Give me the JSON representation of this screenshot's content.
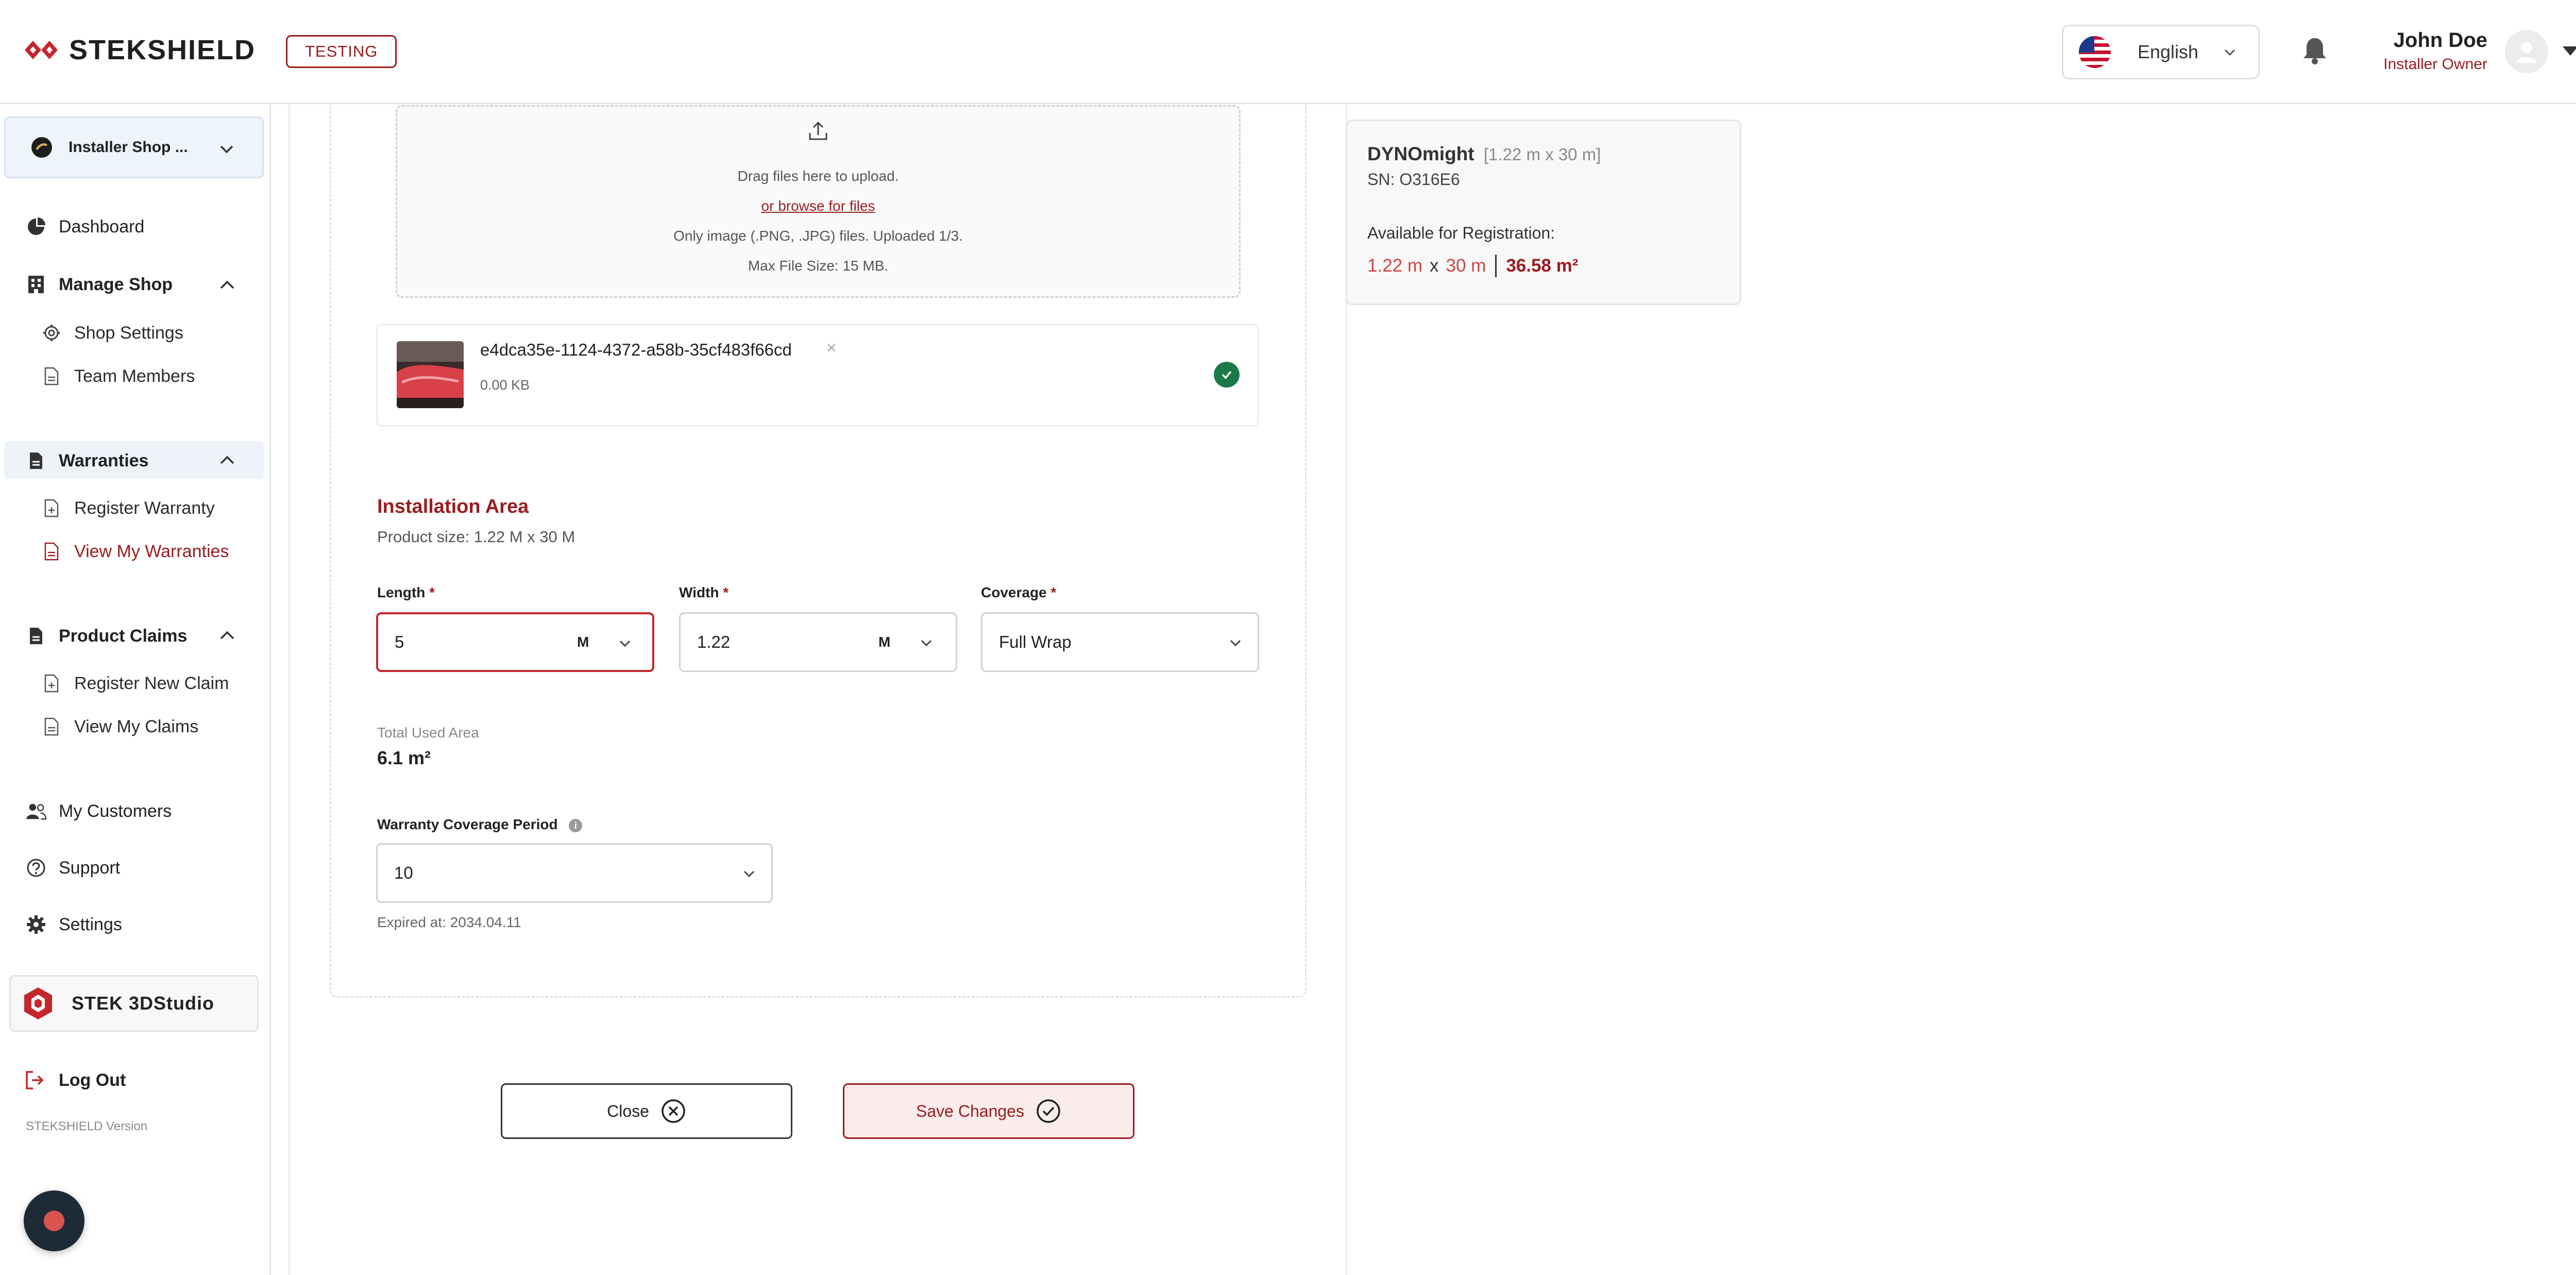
{
  "header": {
    "brand": "STEKSHIELD",
    "env_badge": "TESTING",
    "language": "English",
    "user_name": "John Doe",
    "user_role": "Installer Owner"
  },
  "sidebar": {
    "shop_selector": "Installer Shop ...",
    "dashboard": "Dashboard",
    "manage_shop": "Manage Shop",
    "shop_settings": "Shop Settings",
    "team_members": "Team Members",
    "warranties": "Warranties",
    "register_warranty": "Register Warranty",
    "view_my_warranties": "View My Warranties",
    "product_claims": "Product Claims",
    "register_new_claim": "Register New Claim",
    "view_my_claims": "View My Claims",
    "my_customers": "My Customers",
    "support": "Support",
    "settings": "Settings",
    "stek_studio": "STEK 3DStudio",
    "logout": "Log Out",
    "version": "STEKSHIELD Version"
  },
  "upload": {
    "drag_text": "Drag files here to upload.",
    "browse_link": "or browse for files",
    "file_types": "Only image (.PNG, .JPG) files. Uploaded 1/3.",
    "max_size": "Max File Size: 15 MB.",
    "file_name": "e4dca35e-1124-4372-a58b-35cf483f66cd",
    "file_size": "0.00 KB",
    "remove_glyph": "×"
  },
  "installation": {
    "title": "Installation Area",
    "product_size": "Product size: 1.22 M x 30 M",
    "length_label": "Length",
    "length_value": "5",
    "length_unit": "M",
    "width_label": "Width",
    "width_value": "1.22",
    "width_unit": "M",
    "coverage_label": "Coverage",
    "coverage_value": "Full Wrap",
    "required_mark": "*",
    "total_label": "Total Used Area",
    "total_value": "6.1 m²",
    "warranty_label": "Warranty Coverage Period",
    "warranty_value": "10",
    "expired": "Expired at: 2034.04.11"
  },
  "actions": {
    "close": "Close",
    "save": "Save Changes"
  },
  "product_card": {
    "name": "DYNOmight",
    "dims": "[1.22 m x 30 m]",
    "sn": "SN: O316E6",
    "available_label": "Available for Registration:",
    "width": "1.22 m",
    "x": "x",
    "length": "30 m",
    "total": "36.58 m²"
  },
  "colors": {
    "accent": "#9b1c1f",
    "success": "#1a7a47"
  }
}
